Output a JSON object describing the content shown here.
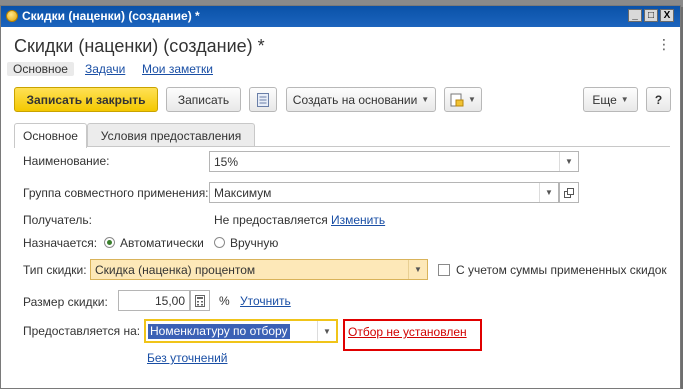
{
  "window": {
    "title": "Скидки (наценки) (создание) *",
    "controls": {
      "minimize": "_",
      "maximize": "□",
      "close": "X"
    }
  },
  "form": {
    "title": "Скидки (наценки) (создание) *",
    "nav": [
      "Основное",
      "Задачи",
      "Мои заметки"
    ]
  },
  "toolbar": {
    "save_close": "Записать и закрыть",
    "save": "Записать",
    "create_based": "Создать на основании",
    "more": "Еще",
    "help": "?"
  },
  "tabs": [
    "Основное",
    "Условия предоставления"
  ],
  "fields": {
    "name_label": "Наименование:",
    "name_value": "15%",
    "group_label": "Группа совместного применения:",
    "group_value": "Максимум",
    "recipient_label": "Получатель:",
    "recipient_value": "Не предоставляется",
    "recipient_change": "Изменить",
    "assigned_label": "Назначается:",
    "assigned_options": [
      "Автоматически",
      "Вручную"
    ],
    "assigned_selected": "Автоматически",
    "type_label": "Тип скидки:",
    "type_value": "Скидка (наценка) процентом",
    "consider_sum_label": "С учетом суммы примененных скидок",
    "consider_sum_checked": false,
    "size_label": "Размер скидки:",
    "size_value": "15,00",
    "size_unit": "%",
    "size_refine": "Уточнить",
    "provided_label": "Предоставляется на:",
    "provided_value": "Номенклатуру по отбору",
    "filter_status": "Отбор не установлен",
    "no_refine": "Без уточнений"
  },
  "colors": {
    "titlebar": "#0a52a8",
    "primary_button": "#f4c800",
    "highlight_field": "#fde8b8",
    "selection": "#3b61b5",
    "alert_border": "#e00000"
  }
}
